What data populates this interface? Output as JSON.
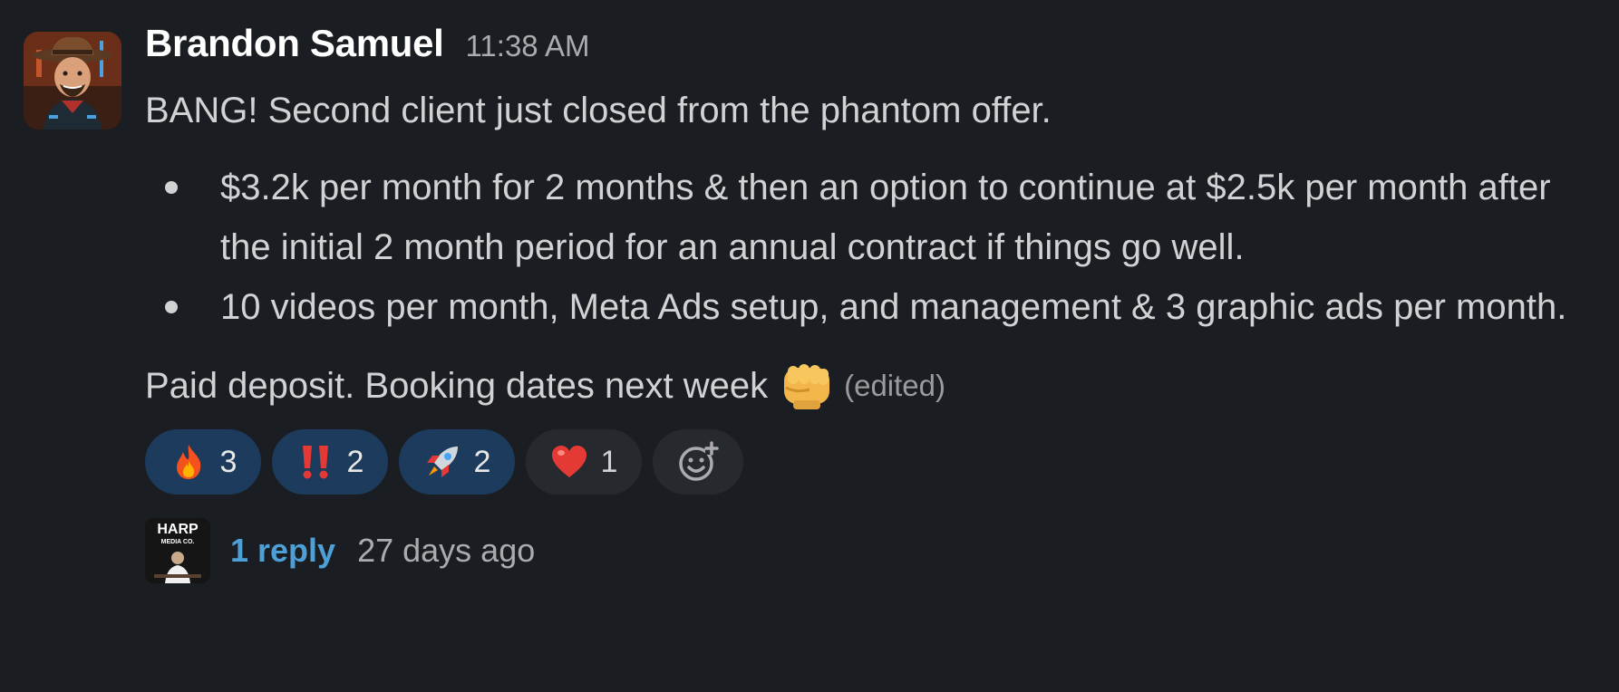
{
  "message": {
    "sender": "Brandon Samuel",
    "timestamp": "11:38 AM",
    "intro": "BANG! Second client just closed from the phantom offer.",
    "bullets": [
      {
        "text": "$3.2k per month for 2 months & then an option to continue at $2.5k per month after the initial 2 month period for an annual contract if things go well."
      },
      {
        "text": "10 videos per month, Meta Ads setup, and management & 3 graphic ads per month."
      }
    ],
    "closing": "Paid deposit. Booking dates next week",
    "closing_emoji": "fist-bump-icon",
    "edited_label": "(edited)"
  },
  "reactions": [
    {
      "emoji": "fire-icon",
      "count": "3",
      "highlighted": true
    },
    {
      "emoji": "double-exclamation-icon",
      "count": "2",
      "highlighted": true
    },
    {
      "emoji": "rocket-icon",
      "count": "2",
      "highlighted": true
    },
    {
      "emoji": "heart-icon",
      "count": "1",
      "highlighted": false
    }
  ],
  "add_reaction_icon": "add-reaction-icon",
  "thread": {
    "avatar_text_1": "HARP",
    "avatar_text_2": "MEDIA CO.",
    "reply_label": "1 reply",
    "reply_time": "27 days ago"
  },
  "colors": {
    "background": "#1a1d21",
    "reaction_highlight": "#1d3b5c",
    "reaction_plain": "#26292e",
    "link": "#4d9fd6"
  }
}
